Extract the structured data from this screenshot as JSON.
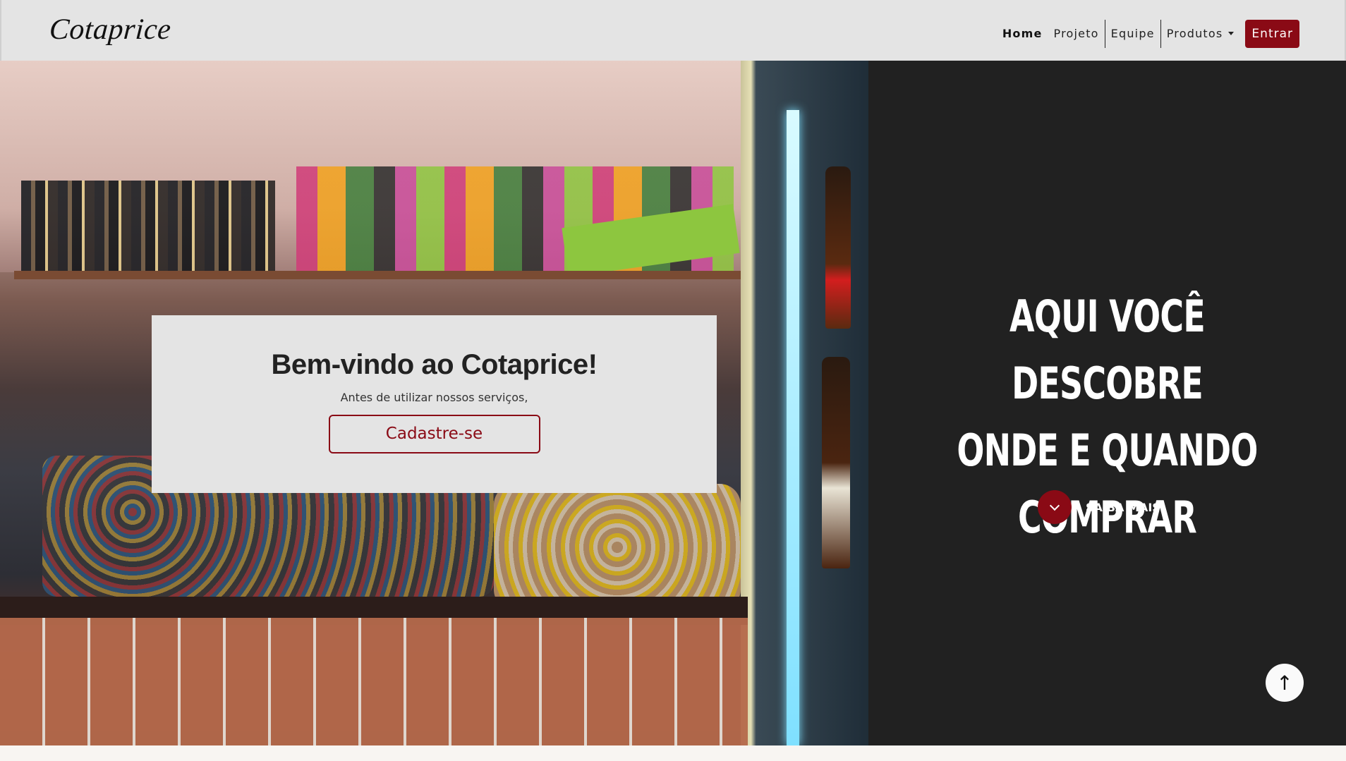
{
  "navbar": {
    "brand": "Cotaprice",
    "links": [
      {
        "label": "Home"
      },
      {
        "label": "Projeto"
      },
      {
        "label": "Equipe"
      },
      {
        "label": "Produtos"
      }
    ],
    "login_label": "Entrar",
    "accent_color": "#8a0a15"
  },
  "hero": {
    "welcome_title": "Bem-vindo ao Cotaprice!",
    "welcome_subtitle": "Antes de utilizar nossos serviços,",
    "signup_label": "Cadastre-se",
    "tagline_lines": [
      "AQUI VOCÊ DESCOBRE",
      "ONDE E QUANDO",
      "COMPRAR"
    ],
    "more_label": "SAIBA MAIS",
    "panel_color": "#212121"
  },
  "back_to_top": {
    "icon": "arrow-up-icon",
    "glyph": "↑"
  }
}
